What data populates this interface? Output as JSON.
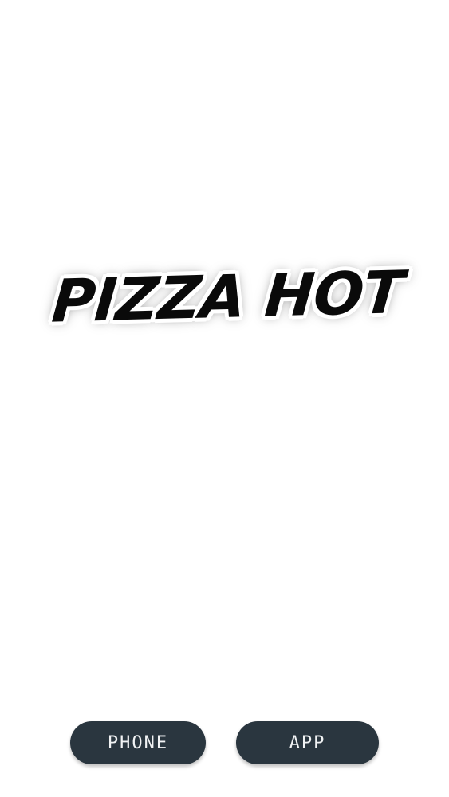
{
  "logo": {
    "text": "PIZZA HOT"
  },
  "buttons": {
    "phone_label": "PHONE",
    "app_label": "APP"
  },
  "colors": {
    "background": "#ffffff",
    "button_background": "#2a363f",
    "button_text": "#f1f3f4",
    "logo_text": "#0a0a0a"
  }
}
